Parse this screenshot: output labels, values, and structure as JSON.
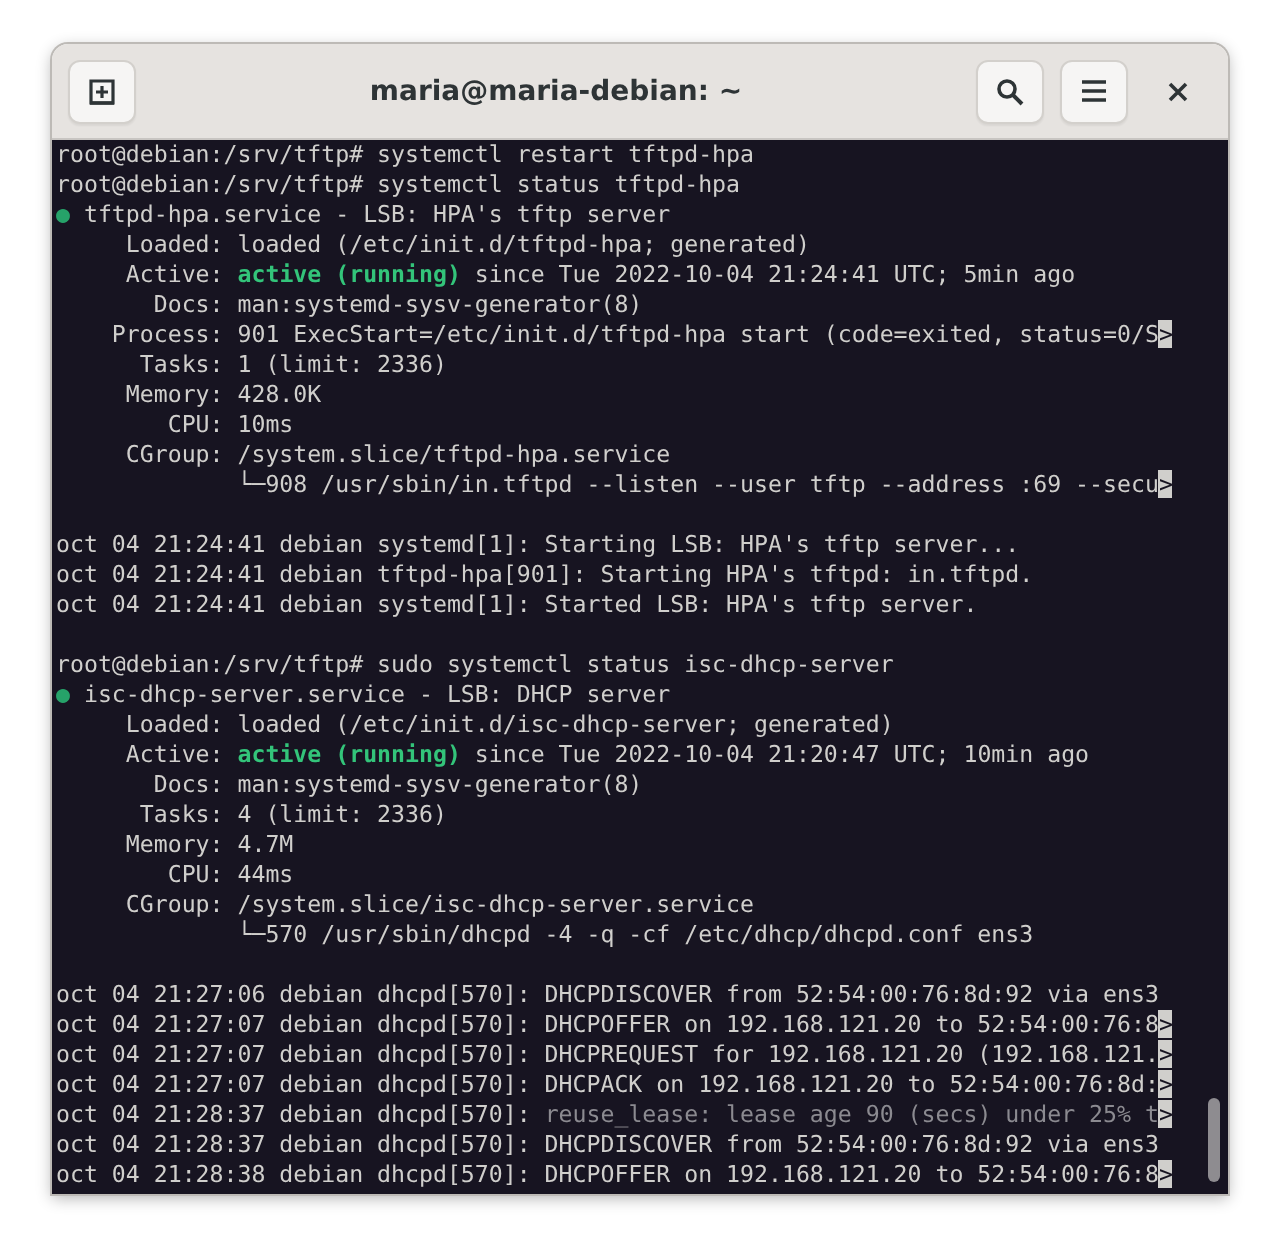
{
  "window": {
    "title": "maria@maria-debian: ~"
  },
  "terminal": {
    "lines": [
      {
        "kind": "text",
        "segments": [
          {
            "kind": "normal",
            "text": "root@debian:/srv/tftp# systemctl restart tftpd-hpa"
          }
        ]
      },
      {
        "kind": "text",
        "segments": [
          {
            "kind": "normal",
            "text": "root@debian:/srv/tftp# systemctl status tftpd-hpa"
          }
        ]
      },
      {
        "kind": "text",
        "segments": [
          {
            "kind": "dot",
            "text": "●"
          },
          {
            "kind": "normal",
            "text": " tftpd-hpa.service - LSB: HPA's tftp server"
          }
        ]
      },
      {
        "kind": "text",
        "segments": [
          {
            "kind": "normal",
            "text": "     Loaded: loaded (/etc/init.d/tftpd-hpa; generated)"
          }
        ]
      },
      {
        "kind": "text",
        "segments": [
          {
            "kind": "normal",
            "text": "     Active: "
          },
          {
            "kind": "active",
            "text": "active (running)"
          },
          {
            "kind": "normal",
            "text": " since Tue 2022-10-04 21:24:41 UTC; 5min ago"
          }
        ]
      },
      {
        "kind": "text",
        "segments": [
          {
            "kind": "normal",
            "text": "       Docs: man:systemd-sysv-generator(8)"
          }
        ]
      },
      {
        "kind": "text",
        "segments": [
          {
            "kind": "normal",
            "text": "    Process: 901 ExecStart=/etc/init.d/tftpd-hpa start (code=exited, status=0/S"
          },
          {
            "kind": "marker",
            "text": ">"
          }
        ]
      },
      {
        "kind": "text",
        "segments": [
          {
            "kind": "normal",
            "text": "      Tasks: 1 (limit: 2336)"
          }
        ]
      },
      {
        "kind": "text",
        "segments": [
          {
            "kind": "normal",
            "text": "     Memory: 428.0K"
          }
        ]
      },
      {
        "kind": "text",
        "segments": [
          {
            "kind": "normal",
            "text": "        CPU: 10ms"
          }
        ]
      },
      {
        "kind": "text",
        "segments": [
          {
            "kind": "normal",
            "text": "     CGroup: /system.slice/tftpd-hpa.service"
          }
        ]
      },
      {
        "kind": "text",
        "segments": [
          {
            "kind": "normal",
            "text": "             └─908 /usr/sbin/in.tftpd --listen --user tftp --address :69 --secu"
          },
          {
            "kind": "marker",
            "text": ">"
          }
        ]
      },
      {
        "kind": "blank"
      },
      {
        "kind": "text",
        "segments": [
          {
            "kind": "normal",
            "text": "oct 04 21:24:41 debian systemd[1]: Starting LSB: HPA's tftp server..."
          }
        ]
      },
      {
        "kind": "text",
        "segments": [
          {
            "kind": "normal",
            "text": "oct 04 21:24:41 debian tftpd-hpa[901]: Starting HPA's tftpd: in.tftpd."
          }
        ]
      },
      {
        "kind": "text",
        "segments": [
          {
            "kind": "normal",
            "text": "oct 04 21:24:41 debian systemd[1]: Started LSB: HPA's tftp server."
          }
        ]
      },
      {
        "kind": "blank"
      },
      {
        "kind": "text",
        "segments": [
          {
            "kind": "normal",
            "text": "root@debian:/srv/tftp# sudo systemctl status isc-dhcp-server"
          }
        ]
      },
      {
        "kind": "text",
        "segments": [
          {
            "kind": "dot",
            "text": "●"
          },
          {
            "kind": "normal",
            "text": " isc-dhcp-server.service - LSB: DHCP server"
          }
        ]
      },
      {
        "kind": "text",
        "segments": [
          {
            "kind": "normal",
            "text": "     Loaded: loaded (/etc/init.d/isc-dhcp-server; generated)"
          }
        ]
      },
      {
        "kind": "text",
        "segments": [
          {
            "kind": "normal",
            "text": "     Active: "
          },
          {
            "kind": "active",
            "text": "active (running)"
          },
          {
            "kind": "normal",
            "text": " since Tue 2022-10-04 21:20:47 UTC; 10min ago"
          }
        ]
      },
      {
        "kind": "text",
        "segments": [
          {
            "kind": "normal",
            "text": "       Docs: man:systemd-sysv-generator(8)"
          }
        ]
      },
      {
        "kind": "text",
        "segments": [
          {
            "kind": "normal",
            "text": "      Tasks: 4 (limit: 2336)"
          }
        ]
      },
      {
        "kind": "text",
        "segments": [
          {
            "kind": "normal",
            "text": "     Memory: 4.7M"
          }
        ]
      },
      {
        "kind": "text",
        "segments": [
          {
            "kind": "normal",
            "text": "        CPU: 44ms"
          }
        ]
      },
      {
        "kind": "text",
        "segments": [
          {
            "kind": "normal",
            "text": "     CGroup: /system.slice/isc-dhcp-server.service"
          }
        ]
      },
      {
        "kind": "text",
        "segments": [
          {
            "kind": "normal",
            "text": "             └─570 /usr/sbin/dhcpd -4 -q -cf /etc/dhcp/dhcpd.conf ens3"
          }
        ]
      },
      {
        "kind": "blank"
      },
      {
        "kind": "text",
        "segments": [
          {
            "kind": "normal",
            "text": "oct 04 21:27:06 debian dhcpd[570]: DHCPDISCOVER from 52:54:00:76:8d:92 via ens3"
          }
        ]
      },
      {
        "kind": "text",
        "segments": [
          {
            "kind": "normal",
            "text": "oct 04 21:27:07 debian dhcpd[570]: DHCPOFFER on 192.168.121.20 to 52:54:00:76:8"
          },
          {
            "kind": "marker",
            "text": ">"
          }
        ]
      },
      {
        "kind": "text",
        "segments": [
          {
            "kind": "normal",
            "text": "oct 04 21:27:07 debian dhcpd[570]: DHCPREQUEST for 192.168.121.20 (192.168.121."
          },
          {
            "kind": "marker",
            "text": ">"
          }
        ]
      },
      {
        "kind": "text",
        "segments": [
          {
            "kind": "normal",
            "text": "oct 04 21:27:07 debian dhcpd[570]: DHCPACK on 192.168.121.20 to 52:54:00:76:8d:"
          },
          {
            "kind": "marker",
            "text": ">"
          }
        ]
      },
      {
        "kind": "text",
        "segments": [
          {
            "kind": "normal",
            "text": "oct 04 21:28:37 debian dhcpd[570]: "
          },
          {
            "kind": "dim",
            "text": "reuse_lease: lease age 90 (secs) under 25% t"
          },
          {
            "kind": "marker",
            "text": ">"
          }
        ]
      },
      {
        "kind": "text",
        "segments": [
          {
            "kind": "normal",
            "text": "oct 04 21:28:37 debian dhcpd[570]: DHCPDISCOVER from 52:54:00:76:8d:92 via ens3"
          }
        ]
      },
      {
        "kind": "text",
        "segments": [
          {
            "kind": "normal",
            "text": "oct 04 21:28:38 debian dhcpd[570]: DHCPOFFER on 192.168.121.20 to 52:54:00:76:8"
          },
          {
            "kind": "marker",
            "text": ">"
          }
        ]
      }
    ]
  }
}
